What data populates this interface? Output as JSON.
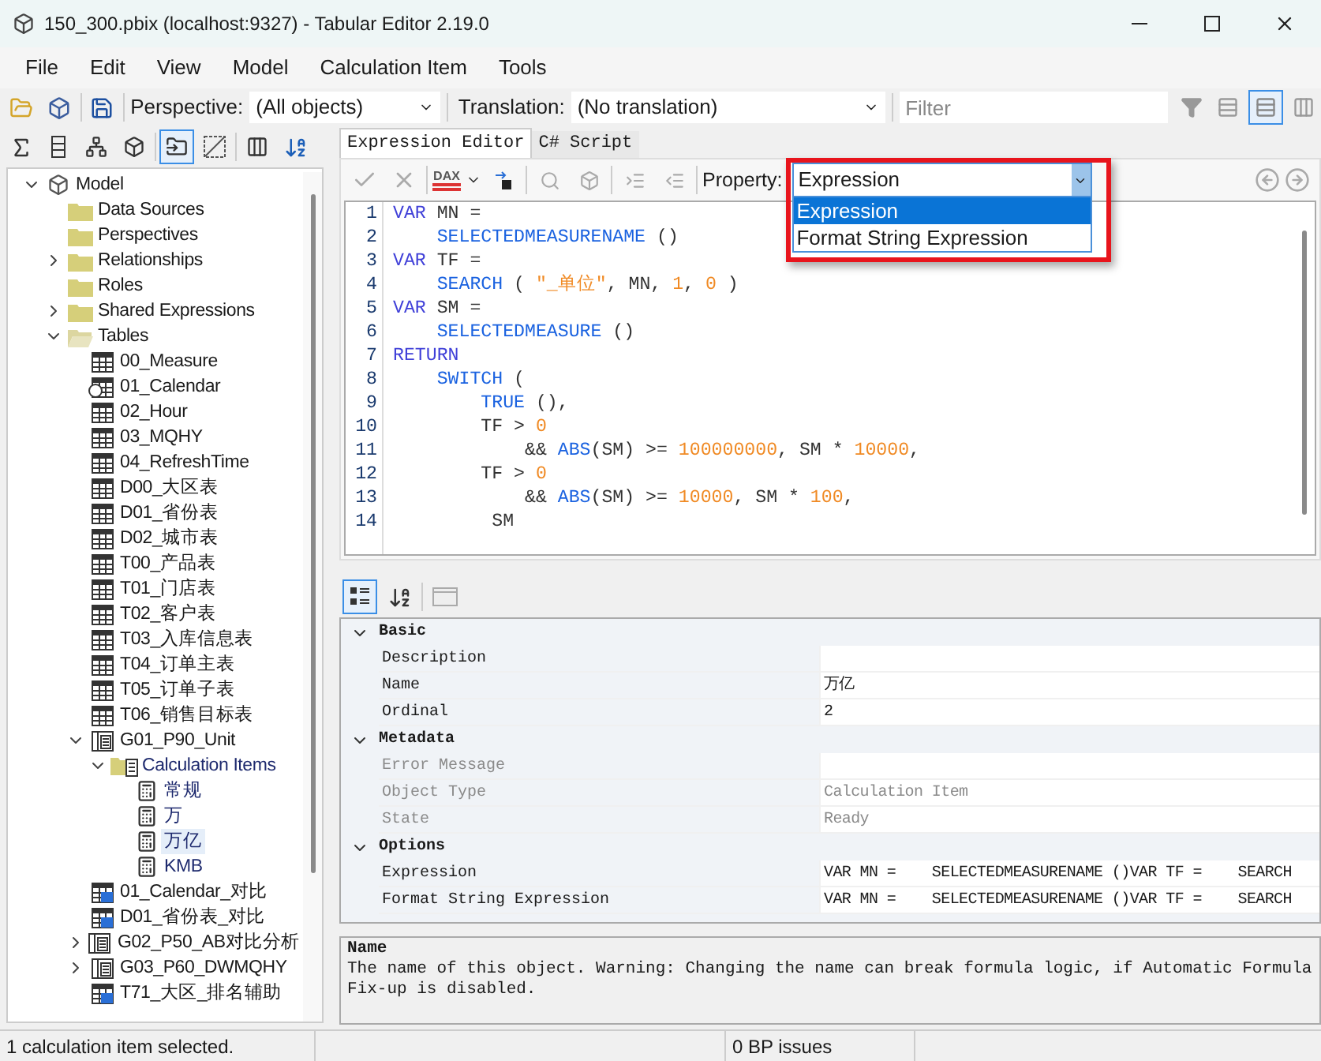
{
  "window": {
    "title": "150_300.pbix (localhost:9327) - Tabular Editor 2.19.0"
  },
  "menu": [
    "File",
    "Edit",
    "View",
    "Model",
    "Calculation Item",
    "Tools"
  ],
  "toolbar": {
    "perspective_label": "Perspective:",
    "perspective_value": "(All objects)",
    "translation_label": "Translation:",
    "translation_value": "(No translation)",
    "filter_placeholder": "Filter"
  },
  "tree": [
    {
      "label": "Model",
      "kind": "model",
      "expanded": true,
      "selected": false,
      "children": [
        {
          "label": "Data Sources",
          "kind": "folder",
          "selected": false
        },
        {
          "label": "Perspectives",
          "kind": "folder",
          "selected": false
        },
        {
          "label": "Relationships",
          "kind": "folder",
          "expanded": false,
          "selected": false
        },
        {
          "label": "Roles",
          "kind": "folder",
          "selected": false
        },
        {
          "label": "Shared Expressions",
          "kind": "folder",
          "expanded": false,
          "selected": false
        },
        {
          "label": "Tables",
          "kind": "folder-open",
          "expanded": true,
          "selected": false,
          "children": [
            {
              "label": "00_Measure",
              "kind": "table",
              "selected": false
            },
            {
              "label": "01_Calendar",
              "kind": "date-table",
              "selected": false
            },
            {
              "label": "02_Hour",
              "kind": "table",
              "selected": false
            },
            {
              "label": "03_MQHY",
              "kind": "table",
              "selected": false
            },
            {
              "label": "04_RefreshTime",
              "kind": "table",
              "selected": false
            },
            {
              "label": "D00_大区表",
              "kind": "table",
              "selected": false
            },
            {
              "label": "D01_省份表",
              "kind": "table",
              "selected": false
            },
            {
              "label": "D02_城市表",
              "kind": "table",
              "selected": false
            },
            {
              "label": "T00_产品表",
              "kind": "table",
              "selected": false
            },
            {
              "label": "T01_门店表",
              "kind": "table",
              "selected": false
            },
            {
              "label": "T02_客户表",
              "kind": "table",
              "selected": false
            },
            {
              "label": "T03_入库信息表",
              "kind": "table",
              "selected": false
            },
            {
              "label": "T04_订单主表",
              "kind": "table",
              "selected": false
            },
            {
              "label": "T05_订单子表",
              "kind": "table",
              "selected": false
            },
            {
              "label": "T06_销售目标表",
              "kind": "table",
              "selected": false
            },
            {
              "label": "G01_P90_Unit",
              "kind": "calc-group",
              "expanded": true,
              "selected": false,
              "children": [
                {
                  "label": "Calculation Items",
                  "kind": "calc-folder",
                  "expanded": true,
                  "selected": false,
                  "children": [
                    {
                      "label": "常规",
                      "kind": "calc-item",
                      "selected": false
                    },
                    {
                      "label": "万",
                      "kind": "calc-item",
                      "selected": false
                    },
                    {
                      "label": "万亿",
                      "kind": "calc-item",
                      "selected": true
                    },
                    {
                      "label": "KMB",
                      "kind": "calc-item",
                      "selected": false
                    }
                  ]
                }
              ]
            },
            {
              "label": "01_Calendar_对比",
              "kind": "calc-table",
              "selected": false
            },
            {
              "label": "D01_省份表_对比",
              "kind": "calc-table",
              "selected": false
            },
            {
              "label": "G02_P50_AB对比分析",
              "kind": "calc-group",
              "expanded": false,
              "selected": false
            },
            {
              "label": "G03_P60_DWMQHY",
              "kind": "calc-group",
              "expanded": false,
              "selected": false
            },
            {
              "label": "T71_大区_排名辅助",
              "kind": "calc-table",
              "selected": false
            }
          ]
        }
      ]
    }
  ],
  "editor_tabs": [
    {
      "label": "Expression Editor",
      "selected": true
    },
    {
      "label": "C# Script",
      "selected": false
    }
  ],
  "editor_toolbar": {
    "dax_label": "DAX",
    "property_label": "Property:",
    "property_value": "Expression"
  },
  "property_dropdown": {
    "options": [
      {
        "label": "Expression",
        "selected": true
      },
      {
        "label": "Format String Expression",
        "selected": false
      }
    ]
  },
  "code": [
    {
      "number": "1",
      "tokens": [
        {
          "kind": "kw",
          "text": "VAR"
        },
        {
          "kind": "plain",
          "text": " MN ="
        }
      ]
    },
    {
      "number": "2",
      "tokens": [
        {
          "kind": "fn",
          "text": "    SELECTEDMEASURENAME"
        },
        {
          "kind": "plain",
          "text": " ()"
        }
      ]
    },
    {
      "number": "3",
      "tokens": [
        {
          "kind": "kw",
          "text": "VAR"
        },
        {
          "kind": "plain",
          "text": " TF ="
        }
      ]
    },
    {
      "number": "4",
      "tokens": [
        {
          "kind": "fn",
          "text": "    SEARCH"
        },
        {
          "kind": "plain",
          "text": " ( "
        },
        {
          "kind": "str",
          "text": "\"_单位\""
        },
        {
          "kind": "plain",
          "text": ", MN, "
        },
        {
          "kind": "num",
          "text": "1"
        },
        {
          "kind": "plain",
          "text": ", "
        },
        {
          "kind": "num",
          "text": "0"
        },
        {
          "kind": "plain",
          "text": " )"
        }
      ]
    },
    {
      "number": "5",
      "tokens": [
        {
          "kind": "kw",
          "text": "VAR"
        },
        {
          "kind": "plain",
          "text": " SM ="
        }
      ]
    },
    {
      "number": "6",
      "tokens": [
        {
          "kind": "fn",
          "text": "    SELECTEDMEASURE"
        },
        {
          "kind": "plain",
          "text": " ()"
        }
      ]
    },
    {
      "number": "7",
      "tokens": [
        {
          "kind": "kw",
          "text": "RETURN"
        }
      ]
    },
    {
      "number": "8",
      "tokens": [
        {
          "kind": "fn",
          "text": "    SWITCH"
        },
        {
          "kind": "plain",
          "text": " ("
        }
      ]
    },
    {
      "number": "9",
      "tokens": [
        {
          "kind": "fn",
          "text": "        TRUE"
        },
        {
          "kind": "plain",
          "text": " (),"
        }
      ]
    },
    {
      "number": "10",
      "tokens": [
        {
          "kind": "plain",
          "text": "        TF > "
        },
        {
          "kind": "num",
          "text": "0"
        }
      ]
    },
    {
      "number": "11",
      "tokens": [
        {
          "kind": "plain",
          "text": "            && "
        },
        {
          "kind": "fn",
          "text": "ABS"
        },
        {
          "kind": "plain",
          "text": "(SM) >= "
        },
        {
          "kind": "num",
          "text": "100000000"
        },
        {
          "kind": "plain",
          "text": ", SM * "
        },
        {
          "kind": "num",
          "text": "10000"
        },
        {
          "kind": "plain",
          "text": ","
        }
      ]
    },
    {
      "number": "12",
      "tokens": [
        {
          "kind": "plain",
          "text": "        TF > "
        },
        {
          "kind": "num",
          "text": "0"
        }
      ]
    },
    {
      "number": "13",
      "tokens": [
        {
          "kind": "plain",
          "text": "            && "
        },
        {
          "kind": "fn",
          "text": "ABS"
        },
        {
          "kind": "plain",
          "text": "(SM) >= "
        },
        {
          "kind": "num",
          "text": "10000"
        },
        {
          "kind": "plain",
          "text": ", SM * "
        },
        {
          "kind": "num",
          "text": "100"
        },
        {
          "kind": "plain",
          "text": ","
        }
      ]
    },
    {
      "number": "14",
      "tokens": [
        {
          "kind": "plain",
          "text": "         SM"
        }
      ]
    }
  ],
  "properties": [
    {
      "category": "Basic",
      "expanded": true,
      "rows": [
        {
          "name": "Description",
          "readonly": false
        },
        {
          "name": "Name",
          "value": "万亿",
          "readonly": false
        },
        {
          "name": "Ordinal",
          "value": "2",
          "readonly": false
        }
      ]
    },
    {
      "category": "Metadata",
      "expanded": true,
      "rows": [
        {
          "name": "Error Message",
          "readonly": true
        },
        {
          "name": "Object Type",
          "value": "Calculation Item",
          "readonly": true
        },
        {
          "name": "State",
          "value": "Ready",
          "readonly": true
        }
      ]
    },
    {
      "category": "Options",
      "expanded": true,
      "rows": [
        {
          "name": "Expression",
          "value": "VAR MN =    SELECTEDMEASURENAME ()VAR TF =    SEARCH",
          "readonly": false
        },
        {
          "name": "Format String Expression",
          "value": "VAR MN =    SELECTEDMEASURENAME ()VAR TF =    SEARCH",
          "readonly": false
        }
      ]
    }
  ],
  "description": {
    "title": "Name",
    "text": "The name of this object. Warning: Changing the name can break formula logic, if Automatic Formula Fix-up is disabled."
  },
  "status_bar": {
    "message": "1 calculation item selected.",
    "bp_issues": "0 BP issues"
  }
}
